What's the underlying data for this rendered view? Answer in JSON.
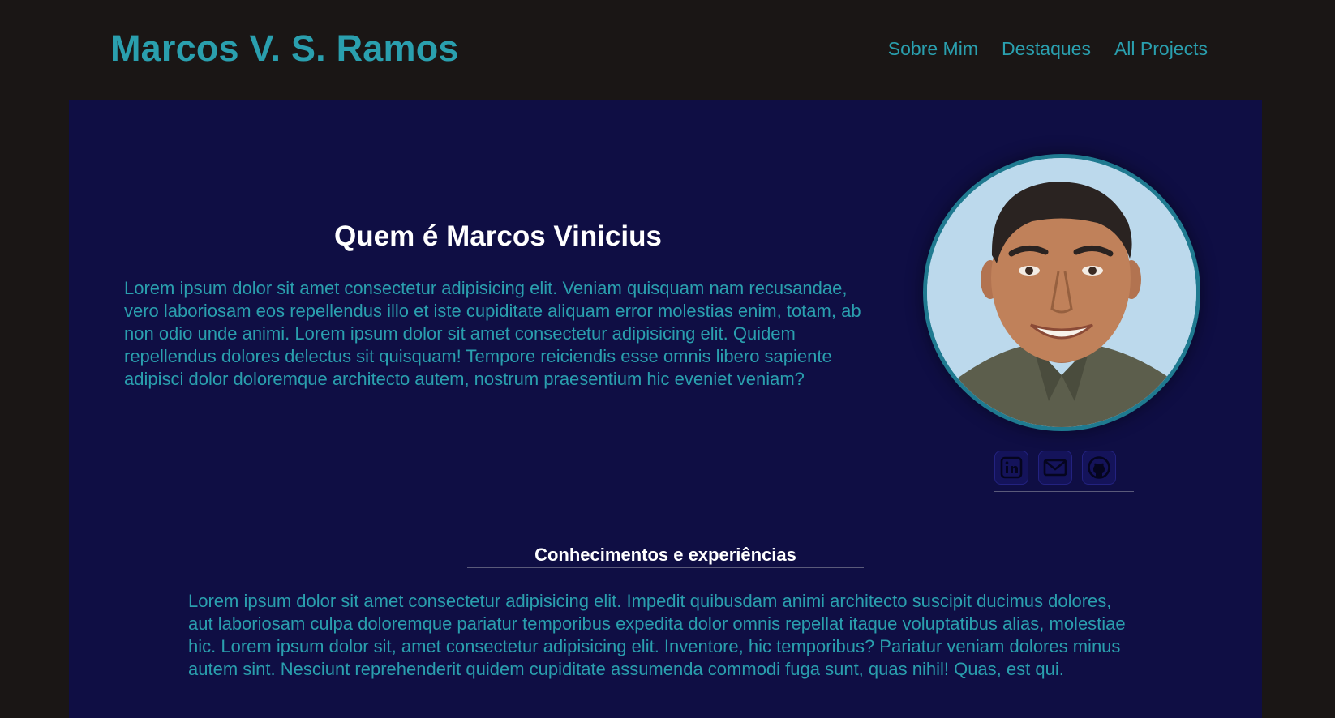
{
  "header": {
    "brand": "Marcos V. S. Ramos",
    "nav": [
      {
        "label": "Sobre Mim"
      },
      {
        "label": "Destaques"
      },
      {
        "label": "All Projects"
      }
    ]
  },
  "about": {
    "title": "Quem é Marcos Vinicius",
    "text": "Lorem ipsum dolor sit amet consectetur adipisicing elit. Veniam quisquam nam recusandae, vero laboriosam eos repellendus illo et iste cupiditate aliquam error molestias enim, totam, ab non odio unde animi. Lorem ipsum dolor sit amet consectetur adipisicing elit. Quidem repellendus dolores delectus sit quisquam! Tempore reiciendis esse omnis libero sapiente adipisci dolor doloremque architecto autem, nostrum praesentium hic eveniet veniam?"
  },
  "socials": [
    {
      "icon": "linkedin-icon"
    },
    {
      "icon": "mail-icon"
    },
    {
      "icon": "github-icon"
    }
  ],
  "skills": {
    "title": "Conhecimentos e experiências",
    "text": "Lorem ipsum dolor sit amet consectetur adipisicing elit. Impedit quibusdam animi architecto suscipit ducimus dolores, aut laboriosam culpa doloremque pariatur temporibus expedita dolor omnis repellat itaque voluptatibus alias, molestiae hic. Lorem ipsum dolor sit, amet consectetur adipisicing elit. Inventore, hic temporibus? Pariatur veniam dolores minus autem sint. Nesciunt reprehenderit quidem cupiditate assumenda commodi fuga sunt, quas nihil! Quas, est qui."
  },
  "colors": {
    "accent": "#2a9fae",
    "main_bg": "#0f0e44",
    "page_bg": "#1a1615",
    "heading": "#ffffff"
  }
}
